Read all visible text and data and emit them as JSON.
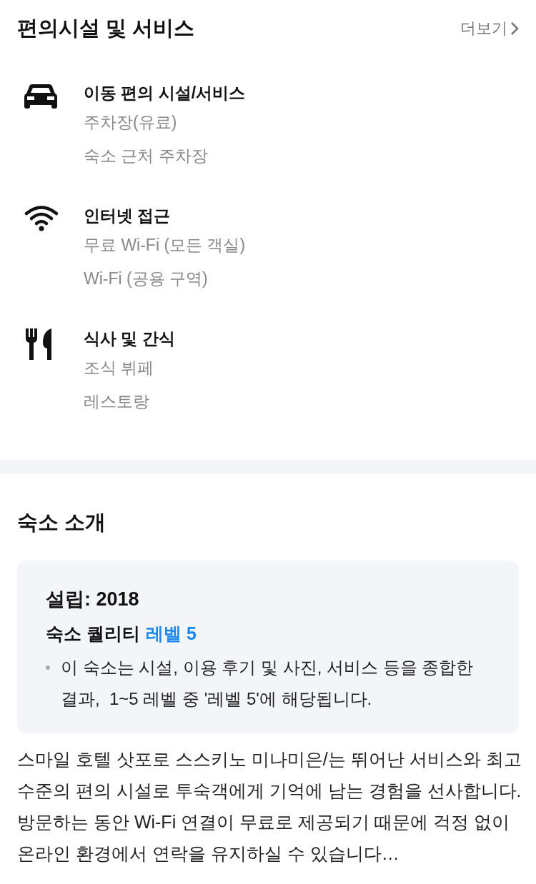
{
  "amenities": {
    "title": "편의시설 및 서비스",
    "more_link": "더보기",
    "groups": [
      {
        "kind": "transport",
        "title": "이동 편의 시설/서비스",
        "items": [
          "주차장(유료)",
          "숙소 근처 주차장"
        ]
      },
      {
        "kind": "internet",
        "title": "인터넷 접근",
        "items": [
          "무료 Wi-Fi (모든 객실)",
          "Wi-Fi (공용 구역)"
        ]
      },
      {
        "kind": "dining",
        "title": "식사 및 간식",
        "items": [
          "조식 뷔페",
          "레스토랑"
        ]
      }
    ]
  },
  "intro": {
    "title": "숙소 소개",
    "card": {
      "established": "설립: 2018",
      "quality_label": "숙소 퀄리티",
      "quality_level": "레벨 5",
      "note": "이 숙소는 시설, 이용 후기 및 사진, 서비스 등을 종합한 결과,  1~5 레벨 중 '레벨 5'에 해당됩니다."
    },
    "description": "스마일 호텔 삿포로 스스키노 미나미은/는 뛰어난 서비스와 최고 수준의 편의 시설로 투숙객에게 기억에 남는 경험을 선사합니다.방문하는 동안 Wi-Fi 연결이 무료로 제공되기 때문에 걱정 없이 온라인 환경에서 연락을 유지하실 수 있습니다…"
  }
}
